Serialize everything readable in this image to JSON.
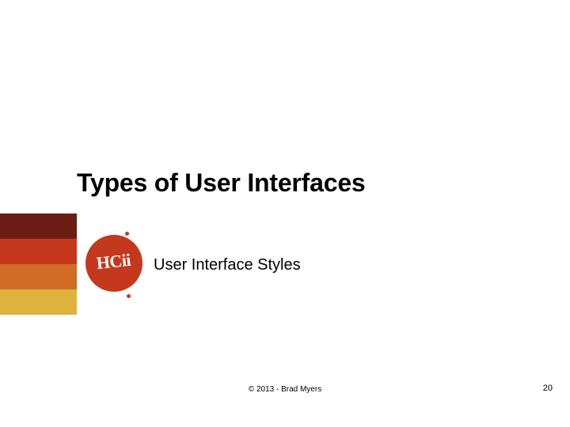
{
  "title": "Types of User Interfaces",
  "subtitle": "User Interface Styles",
  "logo": {
    "label": "HCii"
  },
  "sidebar_colors": [
    "#6b1e14",
    "#c6381e",
    "#d06c25",
    "#ddb33d"
  ],
  "footer": {
    "copyright": "© 2013 - Brad Myers",
    "page": "20"
  }
}
